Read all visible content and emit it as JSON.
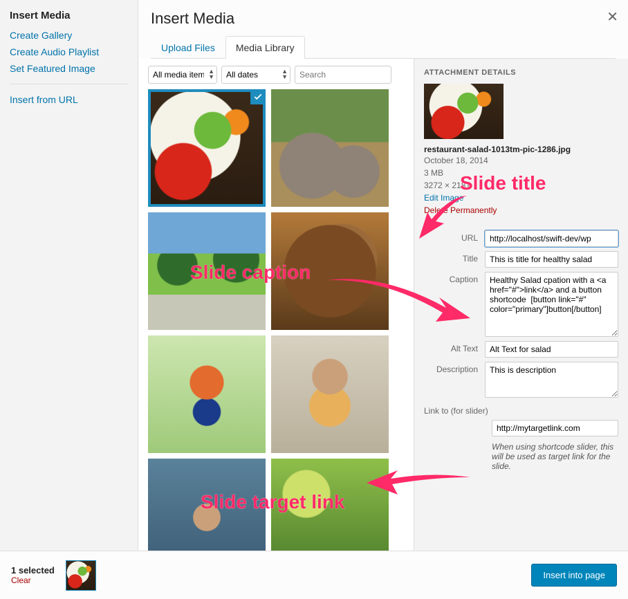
{
  "sidebar": {
    "heading": "Insert Media",
    "links": [
      "Create Gallery",
      "Create Audio Playlist",
      "Set Featured Image"
    ],
    "url_link": "Insert from URL"
  },
  "header": {
    "title": "Insert Media",
    "tabs": [
      "Upload Files",
      "Media Library"
    ],
    "active_tab": 1
  },
  "filters": {
    "media_type": "All media items",
    "date": "All dates",
    "search_placeholder": "Search"
  },
  "thumbs": [
    {
      "name": "salad",
      "cls": "ph-salad",
      "selected": true
    },
    {
      "name": "elephant",
      "cls": "ph-elephant",
      "selected": false
    },
    {
      "name": "park",
      "cls": "ph-park",
      "selected": false
    },
    {
      "name": "bread",
      "cls": "ph-bread",
      "selected": false
    },
    {
      "name": "boy",
      "cls": "ph-boy",
      "selected": false
    },
    {
      "name": "girl",
      "cls": "ph-girl",
      "selected": false
    },
    {
      "name": "girl2",
      "cls": "ph-girl2",
      "selected": false
    },
    {
      "name": "green",
      "cls": "ph-green",
      "selected": false
    }
  ],
  "details": {
    "heading": "ATTACHMENT DETAILS",
    "filename": "restaurant-salad-1013tm-pic-1286.jpg",
    "date": "October 18, 2014",
    "size": "3 MB",
    "dims": "3272 × 2181",
    "edit_label": "Edit Image",
    "delete_label": "Delete Permanently",
    "fields": {
      "url_label": "URL",
      "url_value": "http://localhost/swift-dev/wp",
      "title_label": "Title",
      "title_value": "This is title for healthy salad",
      "caption_label": "Caption",
      "caption_value": "Healthy Salad cpation with a <a href=\"#\">link</a> and a button shortcode  [button link=\"#\" color=\"primary\"]button[/button]",
      "alt_label": "Alt Text",
      "alt_value": "Alt Text for salad",
      "desc_label": "Description",
      "desc_value": "This is description"
    },
    "linkto_label": "Link to (for slider)",
    "linkto_value": "http://mytargetlink.com",
    "linkto_hint": "When using shortcode slider, this will be used as target link for the slide."
  },
  "footer": {
    "selected_text": "1 selected",
    "clear_label": "Clear",
    "insert_label": "Insert into page"
  },
  "annotations": {
    "title": "Slide title",
    "caption": "Slide caption",
    "target": "Slide target link"
  }
}
